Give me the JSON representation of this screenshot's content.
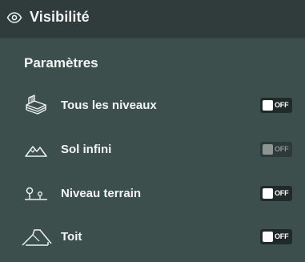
{
  "header": {
    "title": "Visibilité",
    "icon": "eye-icon"
  },
  "section": {
    "title": "Paramètres"
  },
  "settings": [
    {
      "label": "Tous les niveaux",
      "icon": "layers-icon",
      "state": "OFF",
      "enabled": true
    },
    {
      "label": "Sol infini",
      "icon": "mountains-icon",
      "state": "OFF",
      "enabled": false
    },
    {
      "label": "Niveau terrain",
      "icon": "terrain-level-icon",
      "state": "OFF",
      "enabled": true
    },
    {
      "label": "Toit",
      "icon": "roof-icon",
      "state": "OFF",
      "enabled": true
    }
  ],
  "colors": {
    "panel_bg": "#3d4f4d",
    "header_bg": "#2f3c3b",
    "toggle_bg": "#1f2a29"
  }
}
